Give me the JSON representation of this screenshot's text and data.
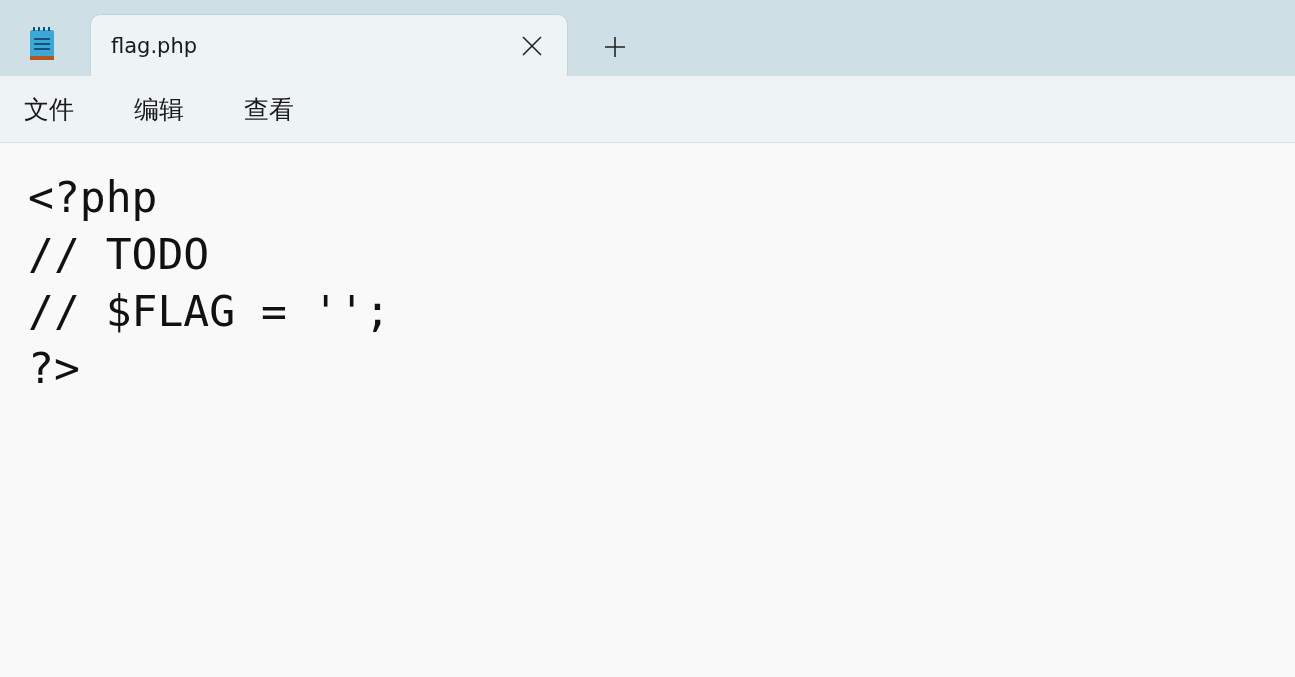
{
  "tabs": [
    {
      "title": "flag.php",
      "selected": true
    }
  ],
  "menu": [
    "文件",
    "编辑",
    "查看"
  ],
  "editor": {
    "lines": [
      "<?php",
      "// TODO",
      "// $FLAG = '';",
      "?>"
    ]
  }
}
